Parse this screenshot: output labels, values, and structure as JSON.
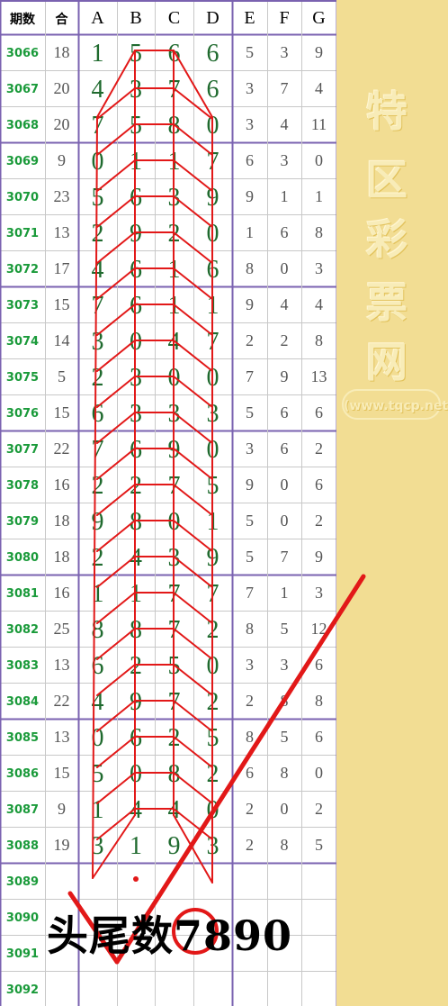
{
  "headers": [
    "期数",
    "合",
    "A",
    "B",
    "C",
    "D",
    "E",
    "F",
    "G"
  ],
  "rows": [
    {
      "period": "3066",
      "sum": "18",
      "A": "1",
      "B": "5",
      "C": "6",
      "D": "6",
      "E": "5",
      "F": "3",
      "G": "9"
    },
    {
      "period": "3067",
      "sum": "20",
      "A": "4",
      "B": "3",
      "C": "7",
      "D": "6",
      "E": "3",
      "F": "7",
      "G": "4"
    },
    {
      "period": "3068",
      "sum": "20",
      "A": "7",
      "B": "5",
      "C": "8",
      "D": "0",
      "E": "3",
      "F": "4",
      "G": "11"
    },
    {
      "period": "3069",
      "sum": "9",
      "A": "0",
      "B": "1",
      "C": "1",
      "D": "7",
      "E": "6",
      "F": "3",
      "G": "0"
    },
    {
      "period": "3070",
      "sum": "23",
      "A": "5",
      "B": "6",
      "C": "3",
      "D": "9",
      "E": "9",
      "F": "1",
      "G": "1"
    },
    {
      "period": "3071",
      "sum": "13",
      "A": "2",
      "B": "9",
      "C": "2",
      "D": "0",
      "E": "1",
      "F": "6",
      "G": "8"
    },
    {
      "period": "3072",
      "sum": "17",
      "A": "4",
      "B": "6",
      "C": "1",
      "D": "6",
      "E": "8",
      "F": "0",
      "G": "3"
    },
    {
      "period": "3073",
      "sum": "15",
      "A": "7",
      "B": "6",
      "C": "1",
      "D": "1",
      "E": "9",
      "F": "4",
      "G": "4"
    },
    {
      "period": "3074",
      "sum": "14",
      "A": "3",
      "B": "0",
      "C": "4",
      "D": "7",
      "E": "2",
      "F": "2",
      "G": "8"
    },
    {
      "period": "3075",
      "sum": "5",
      "A": "2",
      "B": "3",
      "C": "0",
      "D": "0",
      "E": "7",
      "F": "9",
      "G": "13"
    },
    {
      "period": "3076",
      "sum": "15",
      "A": "6",
      "B": "3",
      "C": "3",
      "D": "3",
      "E": "5",
      "F": "6",
      "G": "6"
    },
    {
      "period": "3077",
      "sum": "22",
      "A": "7",
      "B": "6",
      "C": "9",
      "D": "0",
      "E": "3",
      "F": "6",
      "G": "2"
    },
    {
      "period": "3078",
      "sum": "16",
      "A": "2",
      "B": "2",
      "C": "7",
      "D": "5",
      "E": "9",
      "F": "0",
      "G": "6"
    },
    {
      "period": "3079",
      "sum": "18",
      "A": "9",
      "B": "8",
      "C": "0",
      "D": "1",
      "E": "5",
      "F": "0",
      "G": "2"
    },
    {
      "period": "3080",
      "sum": "18",
      "A": "2",
      "B": "4",
      "C": "3",
      "D": "9",
      "E": "5",
      "F": "7",
      "G": "9"
    },
    {
      "period": "3081",
      "sum": "16",
      "A": "1",
      "B": "1",
      "C": "7",
      "D": "7",
      "E": "7",
      "F": "1",
      "G": "3"
    },
    {
      "period": "3082",
      "sum": "25",
      "A": "8",
      "B": "8",
      "C": "7",
      "D": "2",
      "E": "8",
      "F": "5",
      "G": "12"
    },
    {
      "period": "3083",
      "sum": "13",
      "A": "6",
      "B": "2",
      "C": "5",
      "D": "0",
      "E": "3",
      "F": "3",
      "G": "6"
    },
    {
      "period": "3084",
      "sum": "22",
      "A": "4",
      "B": "9",
      "C": "7",
      "D": "2",
      "E": "2",
      "F": "8",
      "G": "8"
    },
    {
      "period": "3085",
      "sum": "13",
      "A": "0",
      "B": "6",
      "C": "2",
      "D": "5",
      "E": "8",
      "F": "5",
      "G": "6"
    },
    {
      "period": "3086",
      "sum": "15",
      "A": "5",
      "B": "0",
      "C": "8",
      "D": "2",
      "E": "6",
      "F": "8",
      "G": "0"
    },
    {
      "period": "3087",
      "sum": "9",
      "A": "1",
      "B": "4",
      "C": "4",
      "D": "0",
      "E": "2",
      "F": "0",
      "G": "2"
    },
    {
      "period": "3088",
      "sum": "19",
      "A": "3",
      "B": "1",
      "C": "9",
      "D": "3",
      "E": "2",
      "F": "8",
      "G": "5"
    },
    {
      "period": "3089",
      "sum": "",
      "A": "",
      "B": "",
      "C": "",
      "D": "",
      "E": "",
      "F": "",
      "G": ""
    },
    {
      "period": "3090",
      "sum": "",
      "A": "",
      "B": "",
      "C": "",
      "D": "",
      "E": "",
      "F": "",
      "G": ""
    },
    {
      "period": "3091",
      "sum": "",
      "A": "",
      "B": "",
      "C": "",
      "D": "",
      "E": "",
      "F": "",
      "G": ""
    },
    {
      "period": "3092",
      "sum": "",
      "A": "",
      "B": "",
      "C": "",
      "D": "",
      "E": "",
      "F": "",
      "G": ""
    }
  ],
  "brand_chars": [
    "特",
    "区",
    "彩",
    "票",
    "网"
  ],
  "brand_url": "(www.tqcp.net)",
  "prediction_text": "头尾数7890",
  "colors": {
    "period_green": "#1a9a3a",
    "digit_green": "#1f6a2e",
    "gray_text": "#555555",
    "grid_line": "#c8c8c8",
    "group_line": "#7a62b0",
    "overlay_red": "#e21818",
    "sidebar_bg": "#f2dd93"
  }
}
